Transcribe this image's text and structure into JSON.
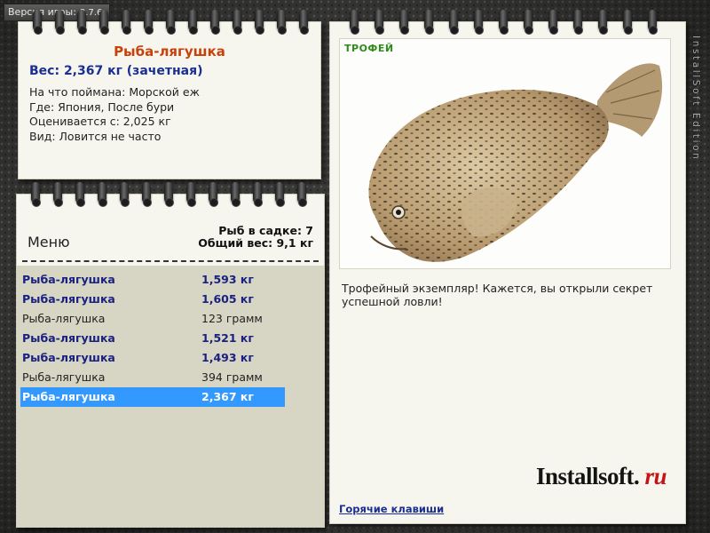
{
  "version": {
    "label": "Версия игры:",
    "number": "3.7.6"
  },
  "fish_info": {
    "name": "Рыба-лягушка",
    "weight_line": "Вес: 2,367 кг (зачетная)",
    "bait_line": "На что поймана: Морской еж",
    "location_line": "Где: Япония, После бури",
    "value_line": "Оценивается с: 2,025 кг",
    "kind_line": "Вид: Ловится не часто"
  },
  "menu": {
    "title": "Меню",
    "fish_count": "Рыб в садке: 7",
    "total_weight": "Общий вес: 9,1 кг",
    "items": [
      {
        "name": "Рыба-лягушка",
        "weight": "1,593 кг",
        "trophy": true
      },
      {
        "name": "Рыба-лягушка",
        "weight": "1,605 кг",
        "trophy": true
      },
      {
        "name": "Рыба-лягушка",
        "weight": "123 грамм",
        "trophy": false
      },
      {
        "name": "Рыба-лягушка",
        "weight": "1,521 кг",
        "trophy": true
      },
      {
        "name": "Рыба-лягушка",
        "weight": "1,493 кг",
        "trophy": true
      },
      {
        "name": "Рыба-лягушка",
        "weight": "394 грамм",
        "trophy": false
      },
      {
        "name": "Рыба-лягушка",
        "weight": "2,367 кг",
        "trophy": true,
        "selected": true
      }
    ]
  },
  "page": {
    "trophy_tag": "ТРОФЕЙ",
    "description": "Трофейный экземпляр! Кажется, вы открыли секрет успешной ловли!",
    "hotkeys_link": "Горячие клавиши",
    "brand_main": "Installsoft.",
    "brand_suffix": "ru"
  },
  "side_text": "InstallSoft Edition",
  "colors": {
    "accent_orange": "#c7420b",
    "trophy_blue": "#1a2180",
    "selection": "#3399ff",
    "trophy_green": "#2f8a1c"
  },
  "icons": [
    "fish-photo",
    "spiral-ring"
  ]
}
